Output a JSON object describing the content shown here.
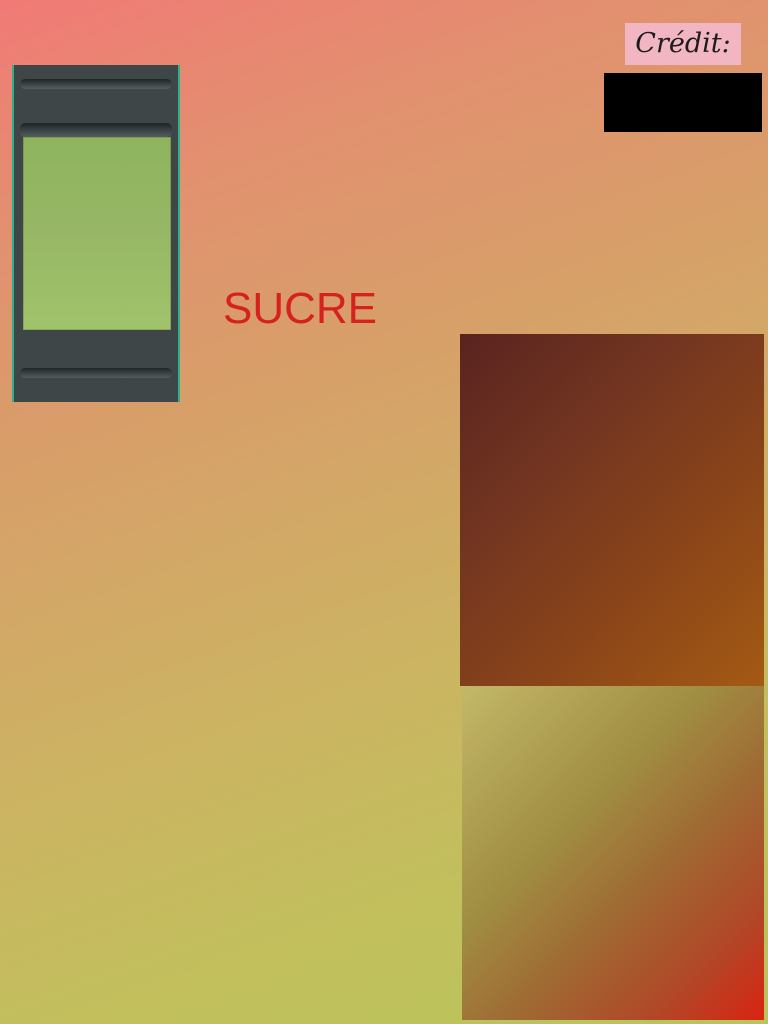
{
  "labels": {
    "title": "SUCRE",
    "credit_label": "Crédit:",
    "credit_value": ""
  },
  "colors": {
    "label_red": "#d5221e",
    "credit_badge": "#f2b6c3",
    "credit_box": "#000000",
    "lcd_green": "#97b766",
    "device_body": "#3f4648",
    "panel_brown": "#743621",
    "panel_olive": "#a08e43"
  },
  "icons": {
    "device": "lcd-device-icon"
  }
}
